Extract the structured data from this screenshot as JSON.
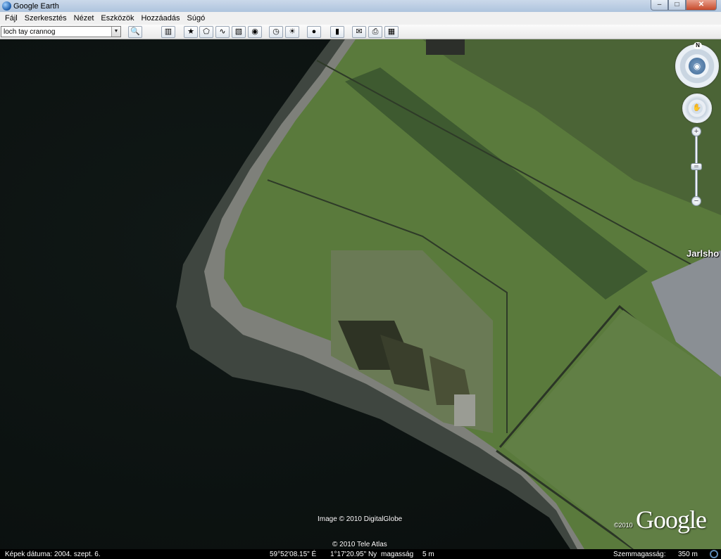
{
  "window": {
    "title": "Google Earth",
    "controls": {
      "minimize": "–",
      "maximize": "□",
      "close": "✕"
    }
  },
  "menu": {
    "items": [
      "Fájl",
      "Szerkesztés",
      "Nézet",
      "Eszközök",
      "Hozzáadás",
      "Súgó"
    ]
  },
  "toolbar": {
    "search_value": "loch tay crannog",
    "dropdown_arrow": "▼",
    "buttons": [
      {
        "icon": "search-icon",
        "glyph": "🔍"
      },
      {
        "icon": "sidebar-icon",
        "glyph": "▥"
      },
      {
        "icon": "add-placemark-icon",
        "glyph": "★"
      },
      {
        "icon": "add-polygon-icon",
        "glyph": "⬠"
      },
      {
        "icon": "add-path-icon",
        "glyph": "∿"
      },
      {
        "icon": "add-image-overlay-icon",
        "glyph": "▧"
      },
      {
        "icon": "record-tour-icon",
        "glyph": "◉"
      },
      {
        "icon": "historical-imagery-icon",
        "glyph": "◷"
      },
      {
        "icon": "sunlight-icon",
        "glyph": "☀"
      },
      {
        "icon": "planets-icon",
        "glyph": "●"
      },
      {
        "icon": "ruler-icon",
        "glyph": "▮"
      },
      {
        "icon": "email-icon",
        "glyph": "✉"
      },
      {
        "icon": "print-icon",
        "glyph": "⎙"
      },
      {
        "icon": "view-in-maps-icon",
        "glyph": "▦"
      }
    ]
  },
  "navigation": {
    "compass_label": "N",
    "look_glyph": "◉",
    "move_glyph": "✋",
    "zoom_in": "+",
    "zoom_out": "−",
    "zoom_knob": "═"
  },
  "map": {
    "place_label": "Jarlsho",
    "image_credit": "Image © 2010 DigitalGlobe",
    "data_credit": "© 2010 Tele Atlas",
    "logo_year": "©2010",
    "logo_text": "Google"
  },
  "status": {
    "imagery_date": "Képek dátuma: 2004. szept. 6.",
    "latitude": "59°52'08.15\" É",
    "longitude": "1°17'20.95\" Ny",
    "elevation_label": "magasság",
    "elevation_value": "5 m",
    "eye_alt_label": "Szemmagasság:",
    "eye_alt_value": "350 m"
  },
  "colors": {
    "sea": "#0f1514",
    "field": "#5a7a3c",
    "crop_strip": "#3e5a30",
    "beach": "#8f8f86",
    "parking": "#8a8f94"
  }
}
